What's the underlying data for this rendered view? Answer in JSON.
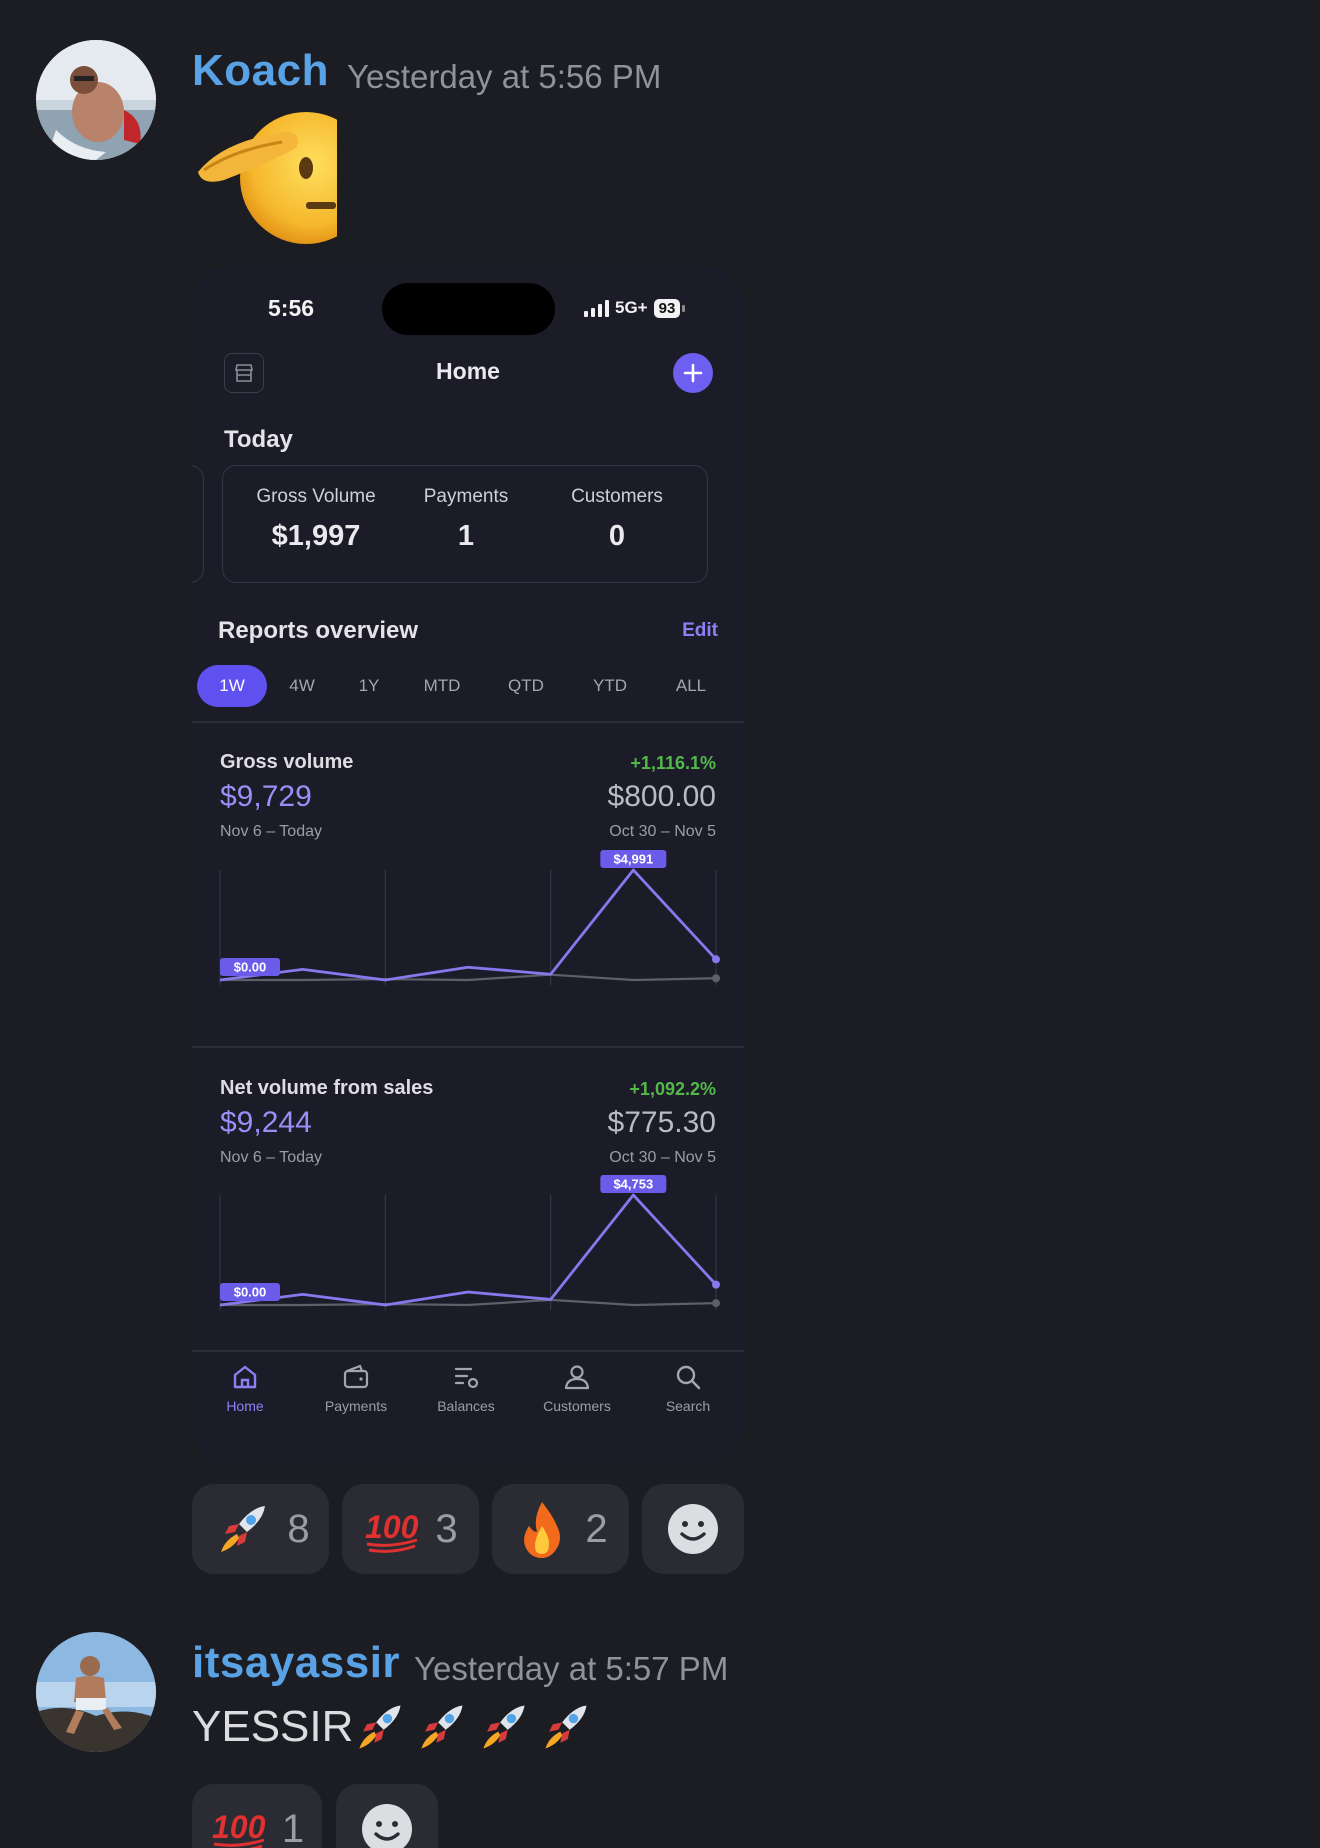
{
  "messages": [
    {
      "username": "Koach",
      "timestamp": "Yesterday at 5:56 PM",
      "reactions": [
        {
          "emoji": "rocket",
          "count": "8"
        },
        {
          "emoji": "hundred",
          "count": "3"
        },
        {
          "emoji": "fire",
          "count": "2"
        },
        {
          "emoji": "add-reaction",
          "count": ""
        }
      ]
    },
    {
      "username": "itsayassir",
      "timestamp": "Yesterday at 5:57 PM",
      "text": "YESSIR",
      "reactions": [
        {
          "emoji": "hundred",
          "count": "1"
        },
        {
          "emoji": "add-reaction",
          "count": ""
        }
      ]
    }
  ],
  "phone": {
    "status": {
      "time": "5:56",
      "network": "5G+",
      "battery": "93"
    },
    "nav_title": "Home",
    "today": {
      "label": "Today",
      "metrics": [
        {
          "label": "Gross Volume",
          "value": "$1,997"
        },
        {
          "label": "Payments",
          "value": "1"
        },
        {
          "label": "Customers",
          "value": "0"
        }
      ]
    },
    "reports": {
      "title": "Reports overview",
      "edit": "Edit",
      "ranges": [
        "1W",
        "4W",
        "1Y",
        "MTD",
        "QTD",
        "YTD",
        "ALL"
      ],
      "active_range": "1W"
    },
    "tabs": [
      "Home",
      "Payments",
      "Balances",
      "Customers",
      "Search"
    ],
    "active_tab": "Home"
  },
  "chart_data": [
    {
      "type": "line",
      "title": "Gross volume",
      "value": "$9,729",
      "range": "Nov 6 – Today",
      "change": "+1,116.1%",
      "previous_value": "$800.00",
      "previous_range": "Oct 30 – Nov 5",
      "min_label": "$0.00",
      "max_label": "$4,991",
      "ylim": [
        0,
        4991
      ],
      "series": [
        {
          "name": "",
          "color": "#8878ee",
          "values": [
            0,
            480,
            0,
            580,
            260,
            4991,
            940
          ]
        },
        {
          "name": "",
          "color": "#5d5f69",
          "values": [
            0,
            0,
            40,
            0,
            240,
            0,
            80
          ]
        }
      ]
    },
    {
      "type": "line",
      "title": "Net volume from sales",
      "value": "$9,244",
      "range": "Nov 6 – Today",
      "change": "+1,092.2%",
      "previous_value": "$775.30",
      "previous_range": "Oct 30 – Nov 5",
      "min_label": "$0.00",
      "max_label": "$4,753",
      "ylim": [
        0,
        4753
      ],
      "series": [
        {
          "name": "",
          "color": "#8878ee",
          "values": [
            0,
            460,
            0,
            560,
            240,
            4753,
            880
          ]
        },
        {
          "name": "",
          "color": "#5d5f69",
          "values": [
            0,
            0,
            40,
            0,
            220,
            0,
            80
          ]
        }
      ]
    }
  ]
}
